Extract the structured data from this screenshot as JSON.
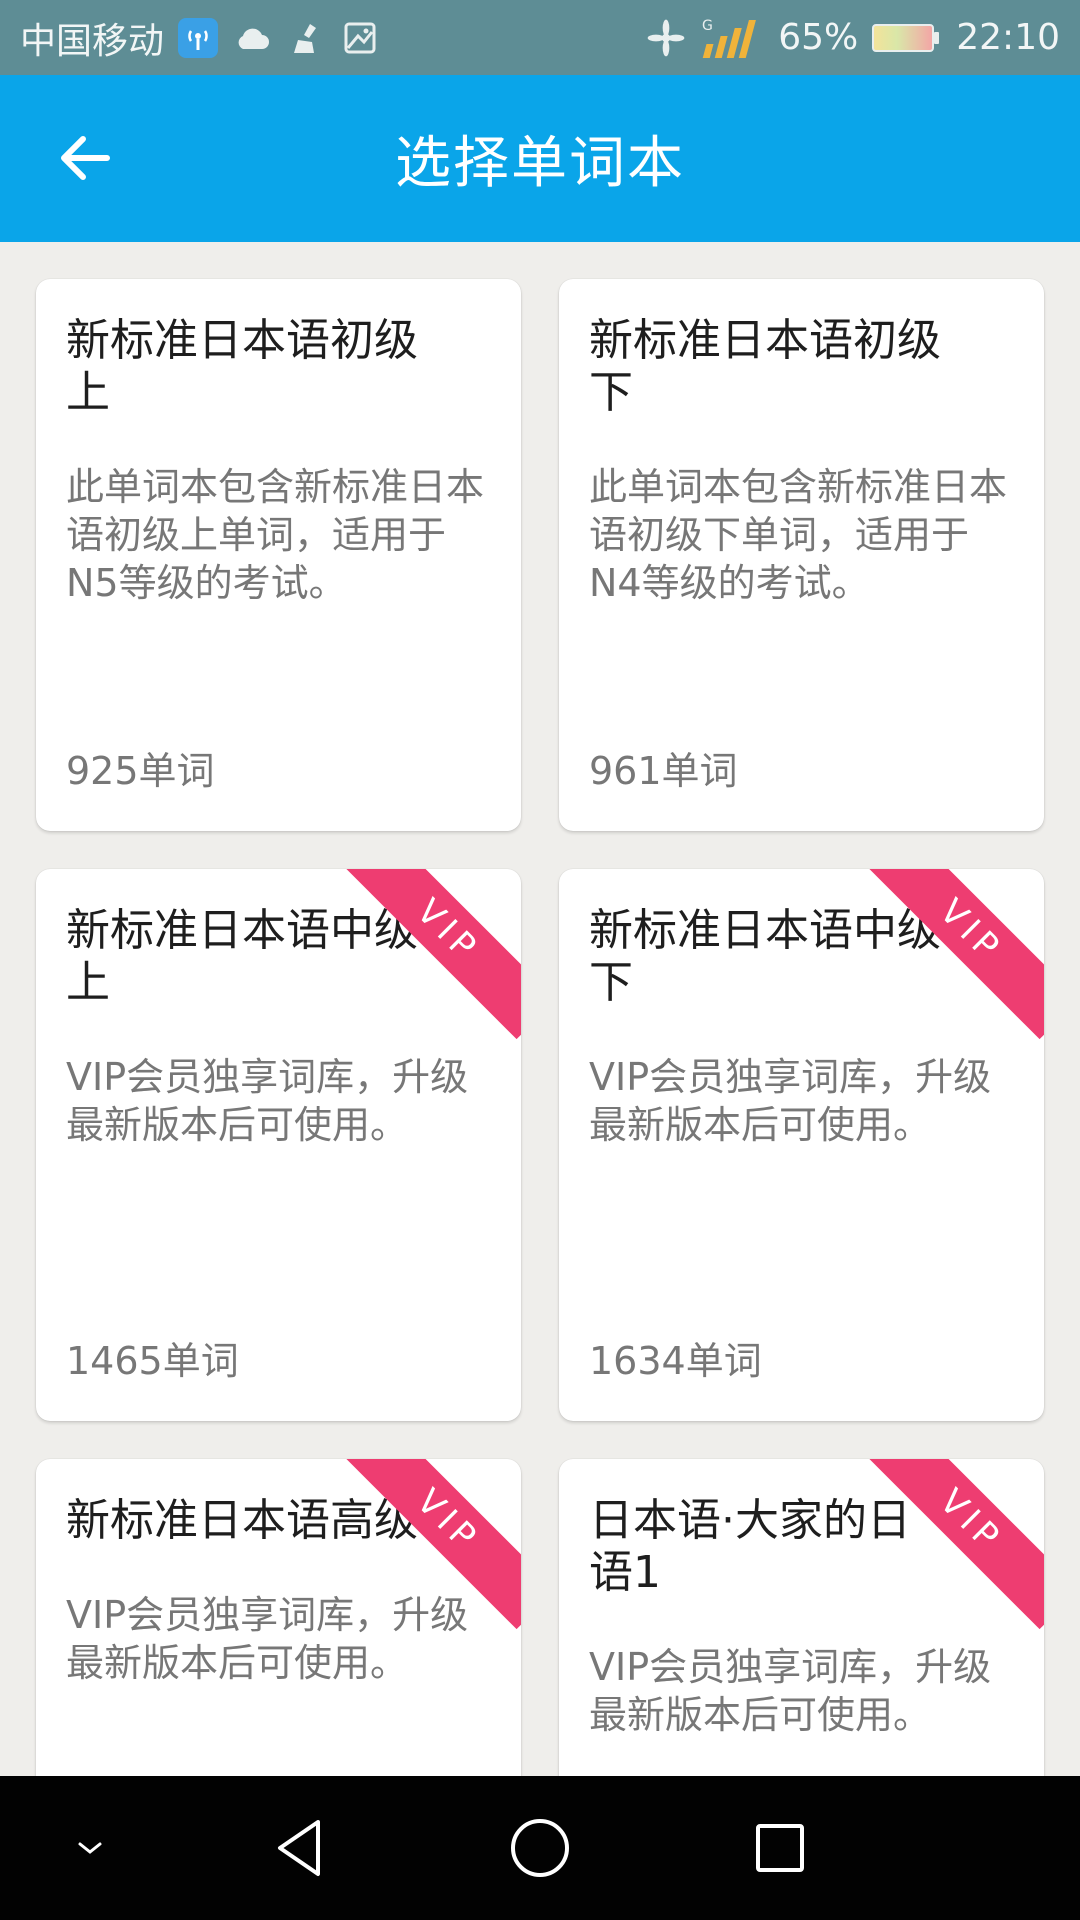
{
  "status_bar": {
    "carrier": "中国移动",
    "battery_percent": "65%",
    "time": "22:10",
    "icons": [
      "hotspot-icon",
      "cloud-icon",
      "cleaner-icon",
      "gallery-icon",
      "fan-icon",
      "signal-icon",
      "battery-icon"
    ]
  },
  "app_bar": {
    "title": "选择单词本",
    "back_icon": "arrow-left-icon"
  },
  "books": [
    {
      "title": "新标准日本语初级上",
      "description": "此单词本包含新标准日本语初级上单词，适用于N5等级的考试。",
      "count": "925单词",
      "vip": false
    },
    {
      "title": "新标准日本语初级下",
      "description": "此单词本包含新标准日本语初级下单词，适用于N4等级的考试。",
      "count": "961单词",
      "vip": false
    },
    {
      "title": "新标准日本语中级上",
      "description": "VIP会员独享词库，升级最新版本后可使用。",
      "count": "1465单词",
      "vip": true
    },
    {
      "title": "新标准日本语中级下",
      "description": "VIP会员独享词库，升级最新版本后可使用。",
      "count": "1634单词",
      "vip": true
    },
    {
      "title": "新标准日本语高级",
      "description": "VIP会员独享词库，升级最新版本后可使用。",
      "count": "",
      "vip": true
    },
    {
      "title": "日本语·大家的日语1",
      "description": "VIP会员独享词库，升级最新版本后可使用。",
      "count": "",
      "vip": true
    }
  ],
  "vip_label": "VIP",
  "colors": {
    "status_bar": "#5e8d95",
    "app_bar": "#0aa5e9",
    "background": "#efeeeb",
    "vip_ribbon": "#ee3d71",
    "nav_bar": "#020202"
  },
  "nav_bar": {
    "icons": [
      "chevron-down-icon",
      "back-triangle-icon",
      "home-circle-icon",
      "recents-square-icon"
    ]
  }
}
